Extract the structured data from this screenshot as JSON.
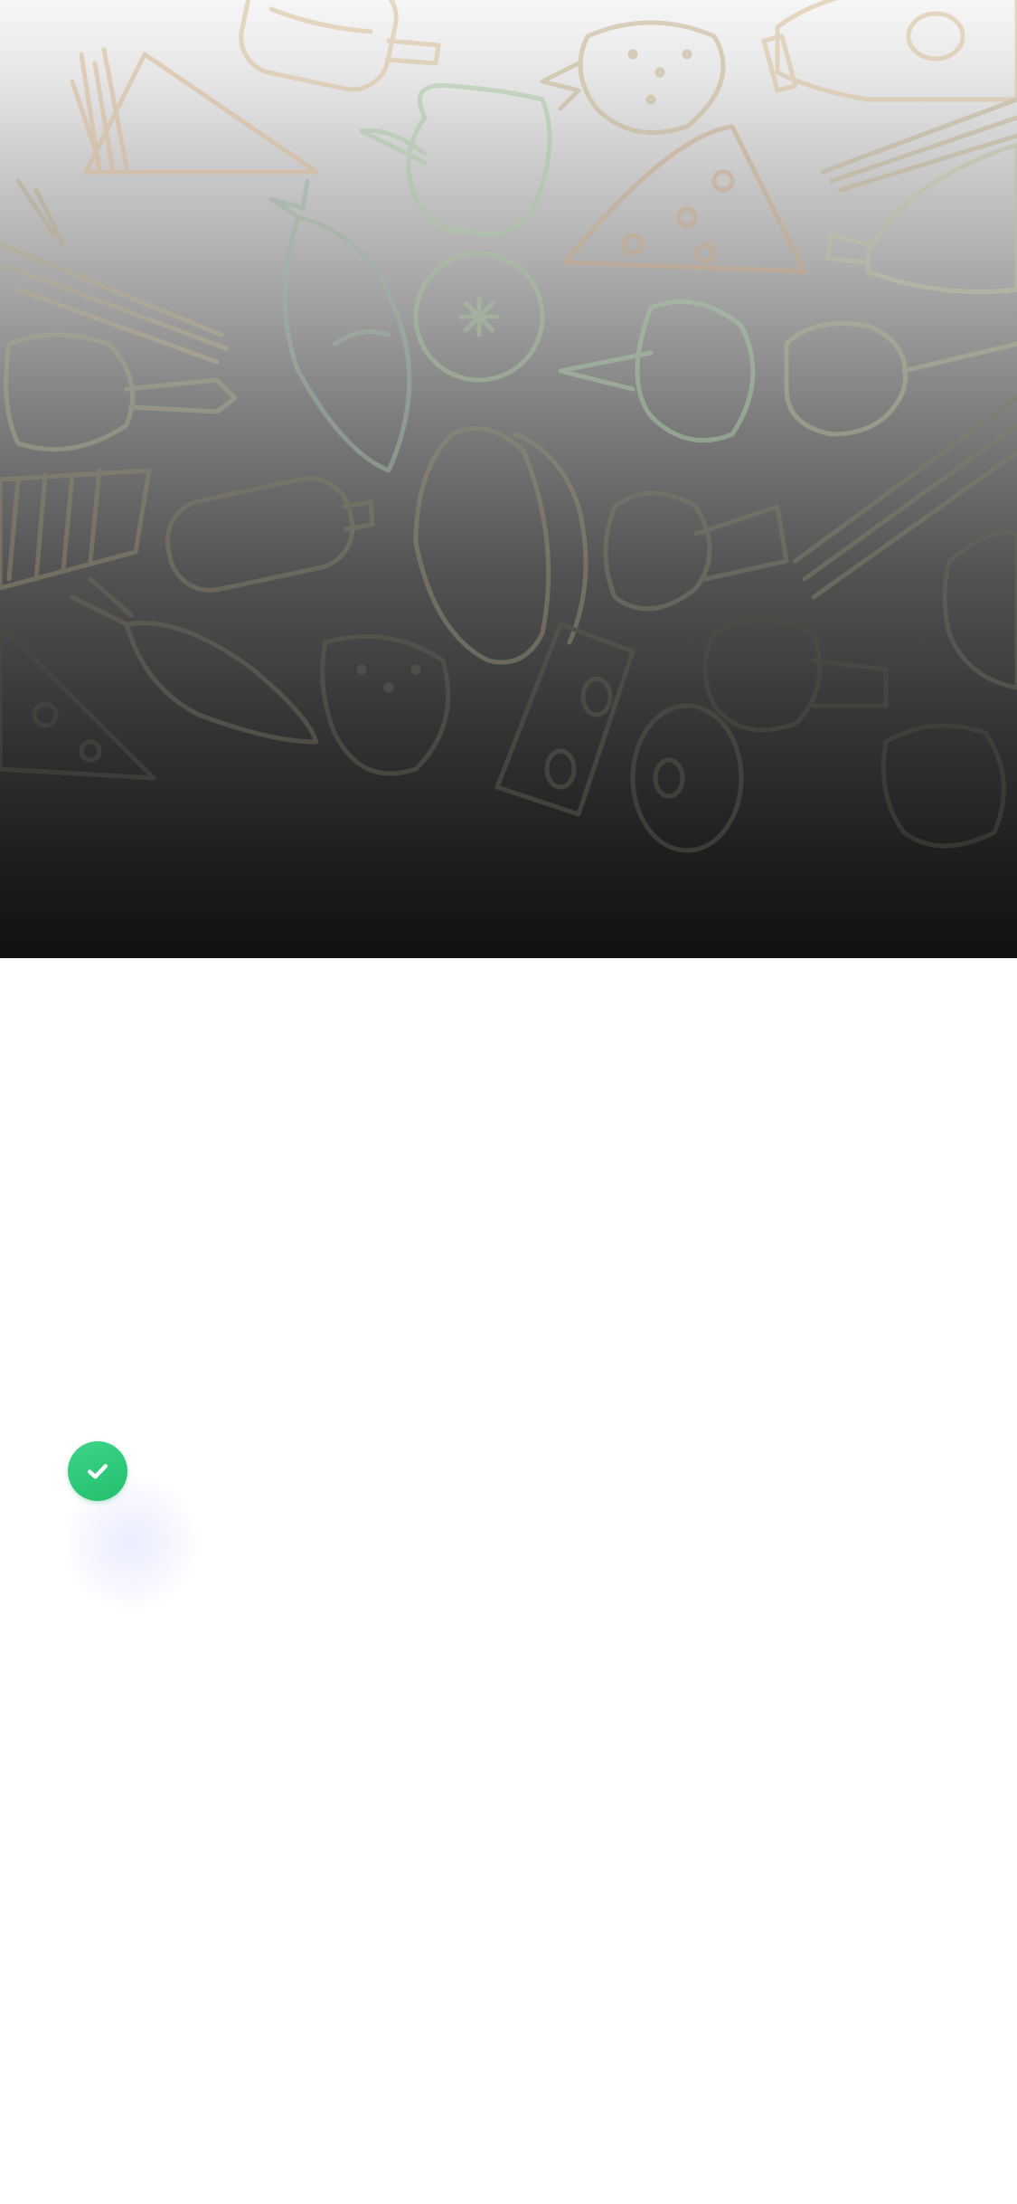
{
  "hero": {
    "background_pattern": "food-doodles",
    "gradient_top": "#f6f6f6",
    "gradient_bottom": "#111111",
    "doodle_colors": [
      "#d7b896",
      "#a9c7a4",
      "#b8ac8a"
    ]
  },
  "status": {
    "icon": "checkmark-icon",
    "color": "#2ecc7a",
    "glow_color": "#eef0ff"
  }
}
